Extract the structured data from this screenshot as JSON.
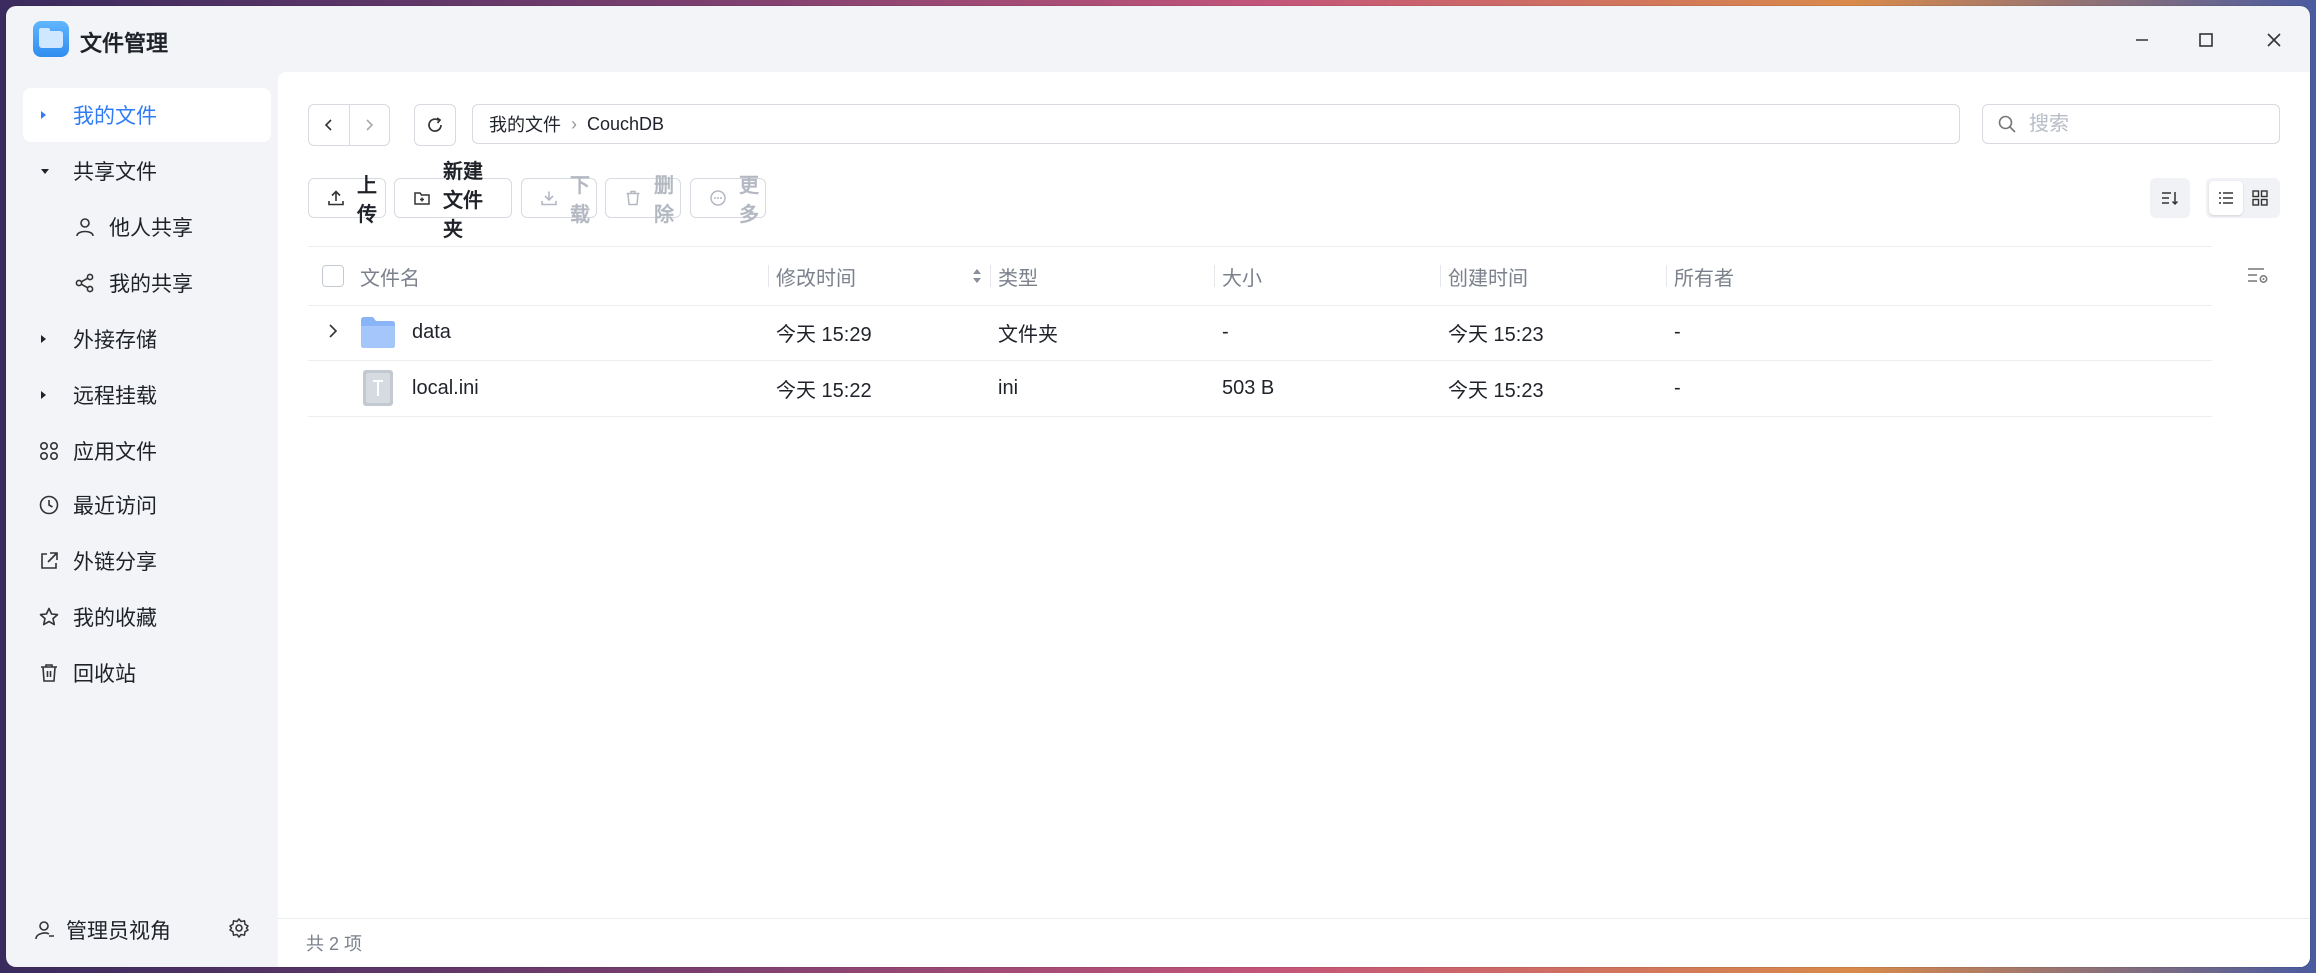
{
  "app": {
    "title": "文件管理"
  },
  "sidebar": {
    "items": [
      {
        "label": "我的文件"
      },
      {
        "label": "共享文件"
      },
      {
        "label": "他人共享"
      },
      {
        "label": "我的共享"
      },
      {
        "label": "外接存储"
      },
      {
        "label": "远程挂载"
      },
      {
        "label": "应用文件"
      },
      {
        "label": "最近访问"
      },
      {
        "label": "外链分享"
      },
      {
        "label": "我的收藏"
      },
      {
        "label": "回收站"
      }
    ],
    "footer": {
      "admin_label": "管理员视角"
    }
  },
  "breadcrumb": {
    "root": "我的文件",
    "current": "CouchDB"
  },
  "search": {
    "placeholder": "搜索"
  },
  "toolbar": {
    "upload": "上传",
    "new_folder": "新建文件夹",
    "download": "下载",
    "delete": "删除",
    "more": "更多"
  },
  "table": {
    "columns": [
      "文件名",
      "修改时间",
      "类型",
      "大小",
      "创建时间",
      "所有者"
    ],
    "rows": [
      {
        "name": "data",
        "modified": "今天 15:29",
        "type": "文件夹",
        "size": "-",
        "created": "今天 15:23",
        "owner": "-"
      },
      {
        "name": "local.ini",
        "modified": "今天 15:22",
        "type": "ini",
        "size": "503 B",
        "created": "今天 15:23",
        "owner": "-"
      }
    ]
  },
  "status": {
    "count_text": "共 2 项"
  },
  "colors": {
    "accent": "#2f7cf6",
    "folder": "#8ab4f8"
  }
}
